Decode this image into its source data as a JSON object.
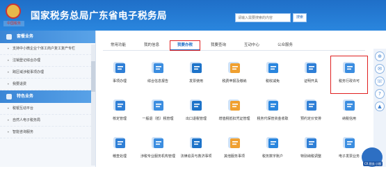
{
  "header": {
    "title": "国家税务总局广东省电子税务局",
    "logo_text": "中国税务",
    "search_placeholder": "请输入需要搜索的内容",
    "search_button": "搜索"
  },
  "sidebar": {
    "section1_title": "套餐业务",
    "section1_items": [
      "支持中小微企业个体工商户复工复产专栏",
      "注销登记综合办理",
      "跨区域涉税事项办理",
      "我要退费"
    ],
    "section2_title": "特色业务",
    "section2_items": [
      "税银互动平台",
      "自然人电子税务局",
      "智能咨询服务"
    ]
  },
  "tabs": [
    "常用功能",
    "我的信息",
    "我要办税",
    "我要查询",
    "互动中心",
    "公众服务"
  ],
  "active_tab": "我要办税",
  "tiles": [
    {
      "label": "事项办理",
      "icon": "edit-icon"
    },
    {
      "label": "综合信息报告",
      "icon": "report-icon"
    },
    {
      "label": "发票使用",
      "icon": "invoice-icon"
    },
    {
      "label": "税费申报及缴纳",
      "icon": "tax-payment-icon"
    },
    {
      "label": "税收减免",
      "icon": "tax-reduction-icon"
    },
    {
      "label": "证明开具",
      "icon": "certificate-icon"
    },
    {
      "label": "税务行政许可",
      "icon": "id-card-icon"
    },
    {
      "label": "核定管理",
      "icon": "verify-icon"
    },
    {
      "label": "一般退（抵）税管理",
      "icon": "refund-icon"
    },
    {
      "label": "出口退税管理",
      "icon": "export-refund-icon"
    },
    {
      "label": "增值税抵扣凭证管理",
      "icon": "vat-icon"
    },
    {
      "label": "税务代保管资金收取",
      "icon": "custody-icon"
    },
    {
      "label": "预约定价安排",
      "icon": "schedule-icon"
    },
    {
      "label": "纳税信用",
      "icon": "credit-icon"
    },
    {
      "label": "稽查处理",
      "icon": "inspection-icon"
    },
    {
      "label": "涉税专业服务机构管理",
      "icon": "agency-icon"
    },
    {
      "label": "法律追责与救济事项",
      "icon": "legal-icon"
    },
    {
      "label": "其他服务事项",
      "icon": "other-icon"
    },
    {
      "label": "税务数字账户",
      "icon": "digital-account-icon"
    },
    {
      "label": "特别纳税调整",
      "icon": "adjustment-icon"
    },
    {
      "label": "电子发票业务",
      "icon": "e-invoice-icon"
    }
  ],
  "mascot_label": "CR 税务 小税",
  "colors": {
    "header": "#1f6fc8",
    "accent": "#1f6fc8",
    "highlight": "#e02020"
  }
}
